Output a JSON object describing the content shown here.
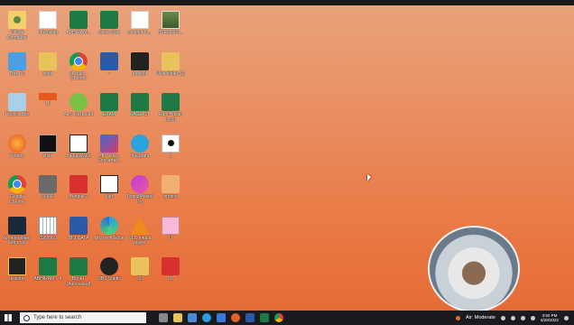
{
  "desktop": {
    "icons": [
      {
        "label": "Village Computer",
        "glyph": "person"
      },
      {
        "label": "Internship",
        "glyph": "doc"
      },
      {
        "label": "ABHIRAM...",
        "glyph": "excel"
      },
      {
        "label": "class chart",
        "glyph": "excel"
      },
      {
        "label": "poolpot fa...",
        "glyph": "doc"
      },
      {
        "label": "BTE36580...",
        "glyph": "photo"
      },
      {
        "label": "This PC",
        "glyph": "pc"
      },
      {
        "label": "shair",
        "glyph": "folder"
      },
      {
        "label": "ai-class - Chrome",
        "glyph": "chrome"
      },
      {
        "label": "~",
        "glyph": "word"
      },
      {
        "label": "poolpot",
        "glyph": "black"
      },
      {
        "label": "New folder (2)",
        "glyph": "folder"
      },
      {
        "label": "Recycle Bin",
        "glyph": "recycle"
      },
      {
        "label": "Ui",
        "glyph": "orange-bar"
      },
      {
        "label": "Avro Keyboard",
        "glyph": "avro"
      },
      {
        "label": "EXAM",
        "glyph": "excel"
      },
      {
        "label": "PAGE CT",
        "glyph": "excel"
      },
      {
        "label": "Rahi Hasan excel",
        "glyph": "excel"
      },
      {
        "label": "Firefox",
        "glyph": "firefox"
      },
      {
        "label": "shair",
        "glyph": "film"
      },
      {
        "label": "BanglaWord",
        "glyph": "bw"
      },
      {
        "label": "HD Video Converter...",
        "glyph": "hd"
      },
      {
        "label": "Telegram",
        "glyph": "telegram"
      },
      {
        "label": "1",
        "glyph": "white-blk"
      },
      {
        "label": "Google Chrome",
        "glyph": "chrome"
      },
      {
        "label": "66666",
        "glyph": "gray"
      },
      {
        "label": "Bengali 2",
        "glyph": "pdf"
      },
      {
        "label": "kari",
        "glyph": "bw"
      },
      {
        "label": "TypingMaster Pro",
        "glyph": "typing"
      },
      {
        "label": "prosno",
        "glyph": "purple"
      },
      {
        "label": "Wondershare Filmora9",
        "glyph": "wonder"
      },
      {
        "label": "6969969",
        "glyph": "grid"
      },
      {
        "label": "BIO DATA",
        "glyph": "word"
      },
      {
        "label": "Microsoft Edge",
        "glyph": "edge"
      },
      {
        "label": "VLC media player",
        "glyph": "vlc"
      },
      {
        "label": "O",
        "glyph": "pink"
      },
      {
        "label": "desktop",
        "glyph": "desk-folder"
      },
      {
        "label": "ABHIRAM... 4",
        "glyph": "excel"
      },
      {
        "label": "Book1 (Autosaved)",
        "glyph": "excel"
      },
      {
        "label": "OBS Studio",
        "glyph": "obs"
      },
      {
        "label": "56",
        "glyph": "folder"
      },
      {
        "label": "58",
        "glyph": "pdf"
      }
    ]
  },
  "taskbar": {
    "search_placeholder": "Type here to search",
    "icons": [
      "task-view",
      "file-explorer",
      "store",
      "edge",
      "mail",
      "firefox",
      "word",
      "excel",
      "chrome"
    ],
    "weather": "Air: Moderate",
    "time": "3:50 PM",
    "date": "6/28/2022"
  }
}
